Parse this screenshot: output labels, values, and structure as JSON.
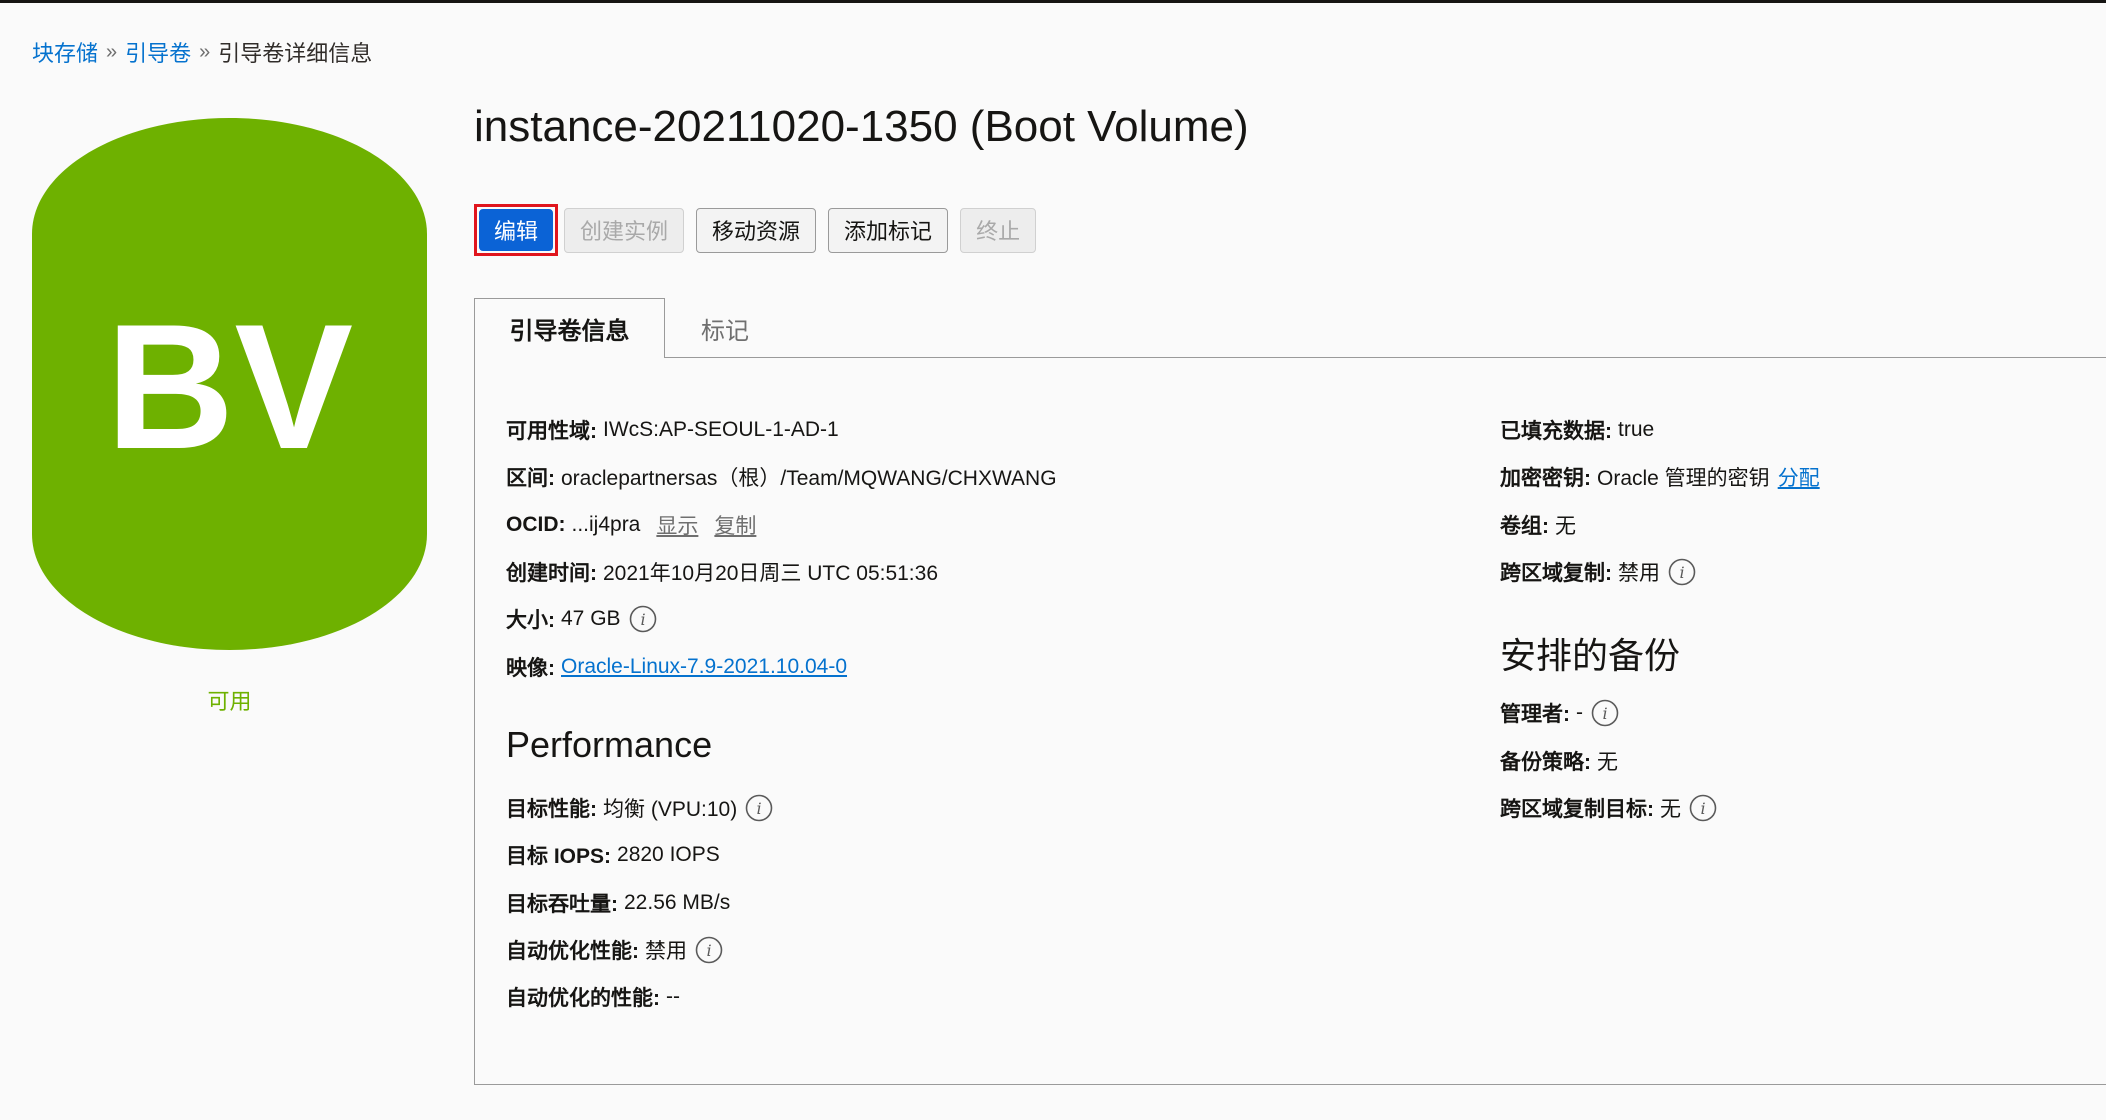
{
  "breadcrumb": {
    "items": [
      "块存储",
      "引导卷"
    ],
    "current": "引导卷详细信息",
    "separator": "»"
  },
  "volume_icon": {
    "text": "BV",
    "color": "#6eb100",
    "status": "可用"
  },
  "page": {
    "title": "instance-20211020-1350 (Boot Volume)"
  },
  "toolbar": {
    "edit": "编辑",
    "create_instance": "创建实例",
    "move_resource": "移动资源",
    "add_tags": "添加标记",
    "terminate": "终止"
  },
  "tabs": {
    "info": "引导卷信息",
    "tags": "标记"
  },
  "left_info": {
    "availability_domain": {
      "label": "可用性域:",
      "value": "IWcS:AP-SEOUL-1-AD-1"
    },
    "compartment": {
      "label": "区间:",
      "value": "oraclepartnersas（根）/Team/MQWANG/CHXWANG"
    },
    "ocid": {
      "label": "OCID:",
      "value": "...ij4pra",
      "show": "显示",
      "copy": "复制"
    },
    "created": {
      "label": "创建时间:",
      "value": "2021年10月20日周三 UTC 05:51:36"
    },
    "size": {
      "label": "大小:",
      "value": "47 GB"
    },
    "image": {
      "label": "映像:",
      "value": "Oracle-Linux-7.9-2021.10.04-0"
    }
  },
  "performance": {
    "heading": "Performance",
    "target_performance": {
      "label": "目标性能:",
      "value": "均衡 (VPU:10)"
    },
    "target_iops": {
      "label": "目标 IOPS:",
      "value": "2820 IOPS"
    },
    "target_throughput": {
      "label": "目标吞吐量:",
      "value": "22.56 MB/s"
    },
    "auto_tune": {
      "label": "自动优化性能:",
      "value": "禁用"
    },
    "auto_tuned": {
      "label": "自动优化的性能:",
      "value": "--"
    }
  },
  "right_info": {
    "hydrated": {
      "label": "已填充数据:",
      "value": "true"
    },
    "encryption_key": {
      "label": "加密密钥:",
      "value": "Oracle 管理的密钥",
      "link": "分配"
    },
    "volume_group": {
      "label": "卷组:",
      "value": "无"
    },
    "cross_region_replication": {
      "label": "跨区域复制:",
      "value": "禁用"
    }
  },
  "backups": {
    "heading": "安排的备份",
    "manager": {
      "label": "管理者:",
      "value": "-"
    },
    "policy": {
      "label": "备份策略:",
      "value": "无"
    },
    "cross_region_target": {
      "label": "跨区域复制目标:",
      "value": "无"
    }
  }
}
